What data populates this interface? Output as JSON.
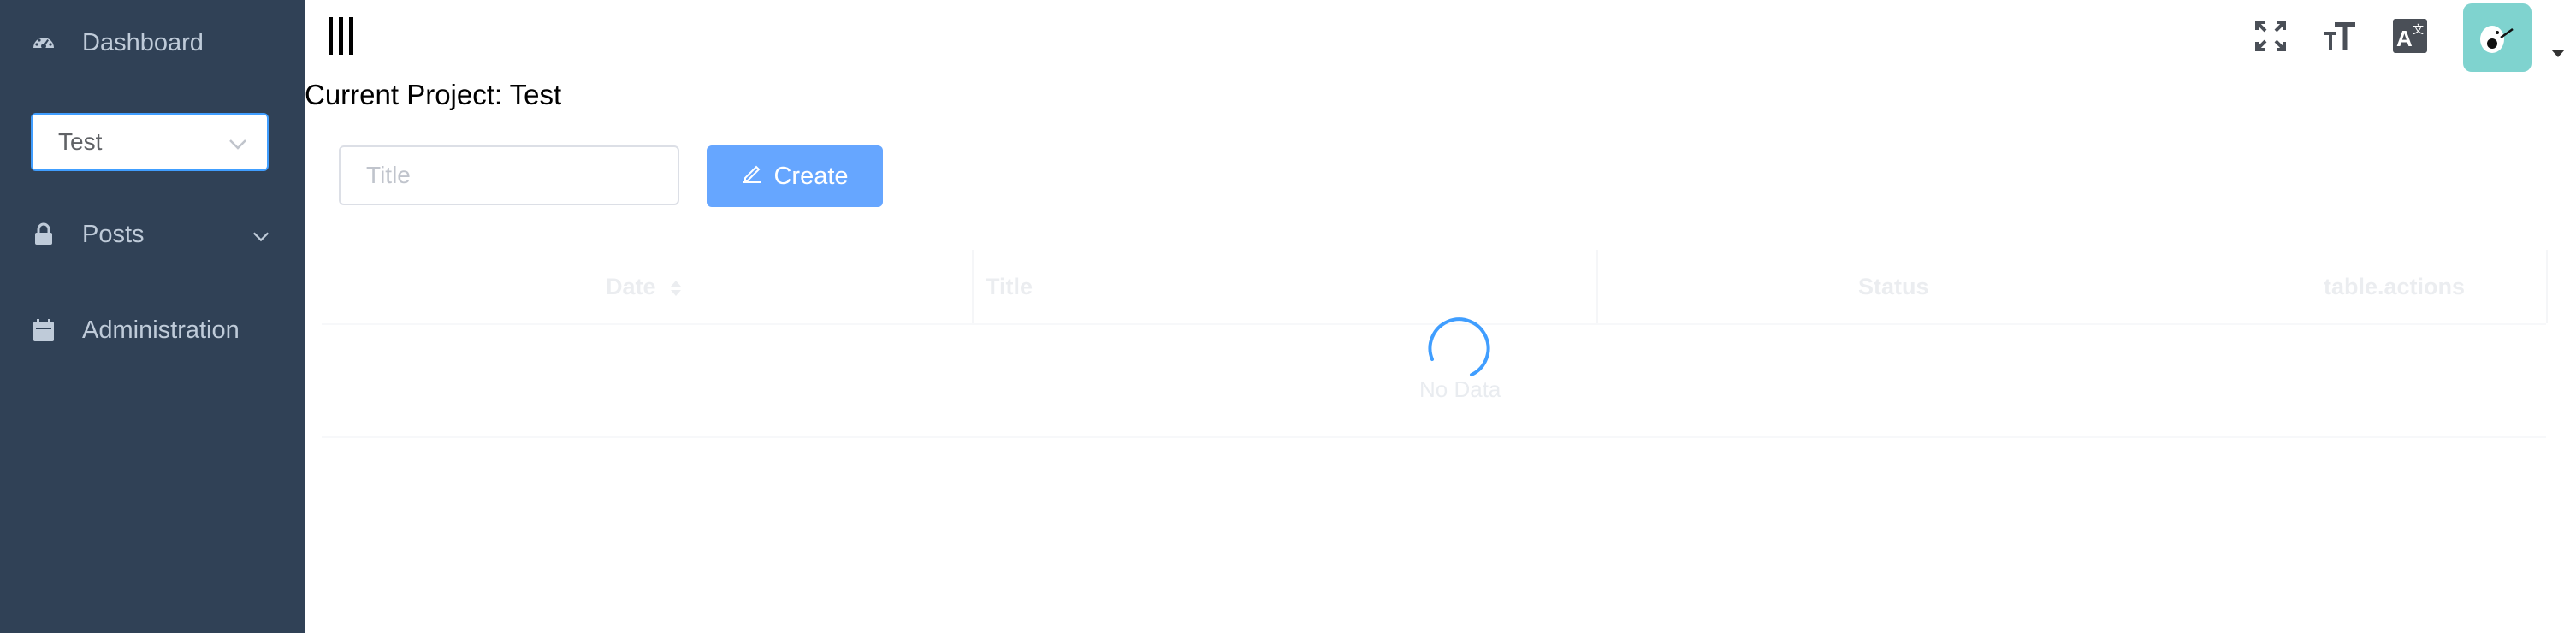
{
  "sidebar": {
    "dashboard_label": "Dashboard",
    "project_select_value": "Test",
    "posts_label": "Posts",
    "administration_label": "Administration"
  },
  "header": {
    "icons": [
      "fullscreen-icon",
      "font-size-icon",
      "translate-icon",
      "avatar"
    ]
  },
  "main": {
    "current_project": "Current Project: Test",
    "title_placeholder": "Title",
    "create_label": "Create"
  },
  "table": {
    "columns": [
      "Date",
      "Title",
      "Status",
      "table.actions"
    ],
    "empty_text": "No Data"
  },
  "colors": {
    "sidebar_bg": "#304156",
    "primary": "#66a6ff",
    "avatar_bg": "#7fd3cf"
  }
}
